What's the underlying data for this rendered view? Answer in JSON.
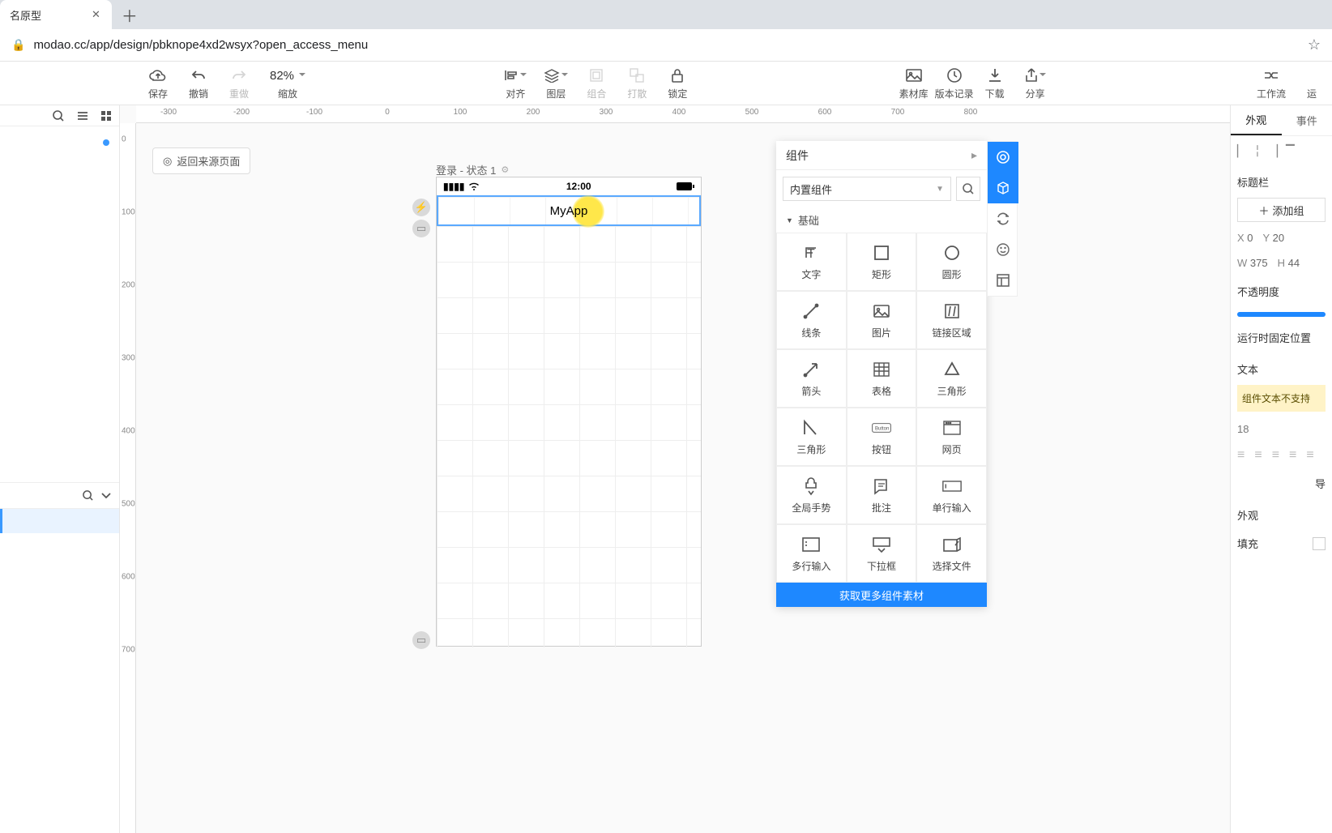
{
  "browser": {
    "tab_title": "名原型",
    "url": "modao.cc/app/design/pbknope4xd2wsyx?open_access_menu"
  },
  "toolbar": {
    "save": "保存",
    "undo": "撤销",
    "redo": "重做",
    "zoom_value": "82%",
    "zoom_label": "缩放",
    "align": "对齐",
    "layer": "图层",
    "group": "组合",
    "ungroup": "打散",
    "lock": "锁定",
    "assets": "素材库",
    "history": "版本记录",
    "download": "下载",
    "share": "分享",
    "workflow": "工作流",
    "run": "运"
  },
  "ruler_h": [
    "-300",
    "-200",
    "-100",
    "0",
    "100",
    "200",
    "300",
    "400",
    "500",
    "600",
    "700",
    "800"
  ],
  "ruler_v": [
    "0",
    "100",
    "200",
    "300",
    "400",
    "500",
    "600",
    "700"
  ],
  "canvas": {
    "back_link": "返回来源页面",
    "page_name": "登录 - 状态 1",
    "status_time": "12:00",
    "title_text": "MyApp"
  },
  "components": {
    "title": "组件",
    "select_value": "内置组件",
    "section": "基础",
    "items": [
      "文字",
      "矩形",
      "圆形",
      "线条",
      "图片",
      "链接区域",
      "箭头",
      "表格",
      "三角形",
      "三角形",
      "按钮",
      "网页",
      "全局手势",
      "批注",
      "单行输入",
      "多行输入",
      "下拉框",
      "选择文件"
    ],
    "more": "获取更多组件素材"
  },
  "right_panel": {
    "tab_appearance": "外观",
    "tab_events": "事件",
    "section_titlebar": "标题栏",
    "add_component": "添加组",
    "x": "0",
    "y": "20",
    "w": "375",
    "h": "44",
    "opacity_label": "不透明度",
    "fixed_label": "运行时固定位置",
    "text_section": "文本",
    "text_warning": "组件文本不支持",
    "font_size": "18",
    "appearance_section": "外观",
    "fill_label": "填充",
    "nav_label": "导"
  }
}
